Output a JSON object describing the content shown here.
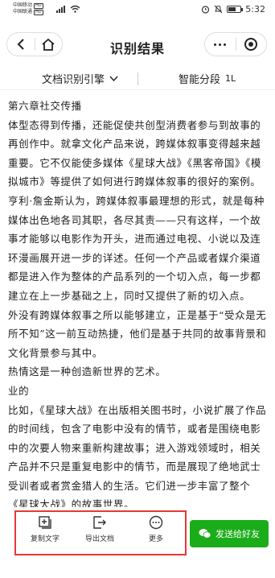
{
  "status_bar": {
    "carrier1": "中国移动",
    "carrier2": "中国联通",
    "hd_badge": "HD",
    "time": "5:32"
  },
  "nav": {
    "title": "识别结果"
  },
  "toolbar": {
    "engine_label": "文档识别引擎",
    "segment_label": "智能分段",
    "segment_icon_text": "1L"
  },
  "content": {
    "paragraphs": [
      "第六章社交传播",
      "体型态得到传播，还能促使共创型消费者参与到故事的再创作中。就拿文化产品来说，跨媒体叙事变得越来越重要。它不仅能使多媒体《星球大战》《黑客帝国》《模拟城市》等提供了如何进行跨媒体叙事的很好的案例。亨利·詹金斯认为，跨媒体叙事最理想的形式，就是每种媒体出色地各司其职，各尽其责——只有这样，一个故事才能够以电影作为开头，进而通过电视、小说以及连环漫画展开进一步的详述。任何一个产品或者媒介渠道都是进入作为整体的产品系列的一个切入点，每一步都建立在上一步基础之上，同时又提供了新的切入点。",
      "外没有跨媒体叙事之所以能够建立，正是基于“受众是无所不知”这一前互动热捷，他们是基于共同的故事背景和文化背景参与其中。",
      "热情这是一种创造新世界的艺术。",
      "业的",
      "比如，《星球大战》在出版相关图书时，小说扩展了作品的时间线，包含了电影中没有的情节，或者是围绕电影中的次要人物来重新构建故事；进入游戏领域时，相关产品并不只是重复电影中的情节，而是展现了绝地武士受训者或者赏金猎人的生活。它们进一步丰富了整个《星球大战》的故事世界。"
    ]
  },
  "bottom_bar": {
    "copy_label": "复制文字",
    "export_label": "导出文档",
    "more_label": "更多",
    "send_label": "发送给好友"
  },
  "colors": {
    "accent_green": "#1aad19",
    "highlight_red": "#e53935"
  }
}
